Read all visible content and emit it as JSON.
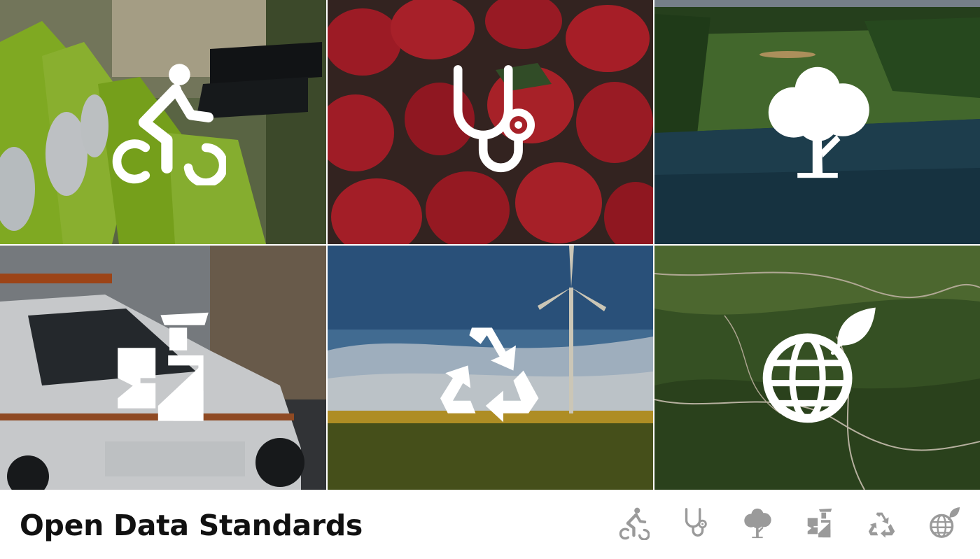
{
  "page_title": "Open Data Standards",
  "colors": {
    "title_text": "#111111",
    "tile_icon": "#ffffff",
    "footer_icon": "#9a9a9a",
    "footer_background": "#ffffff"
  },
  "categories": [
    {
      "icon": "bicycle-icon",
      "photo": "green rental bicycles in a docking station"
    },
    {
      "icon": "stethoscope-icon",
      "photo": "pile of fresh strawberries"
    },
    {
      "icon": "tree-icon",
      "photo": "aerial view of a park with a lake"
    },
    {
      "icon": "police-officer-icon",
      "photo": "police car parked on a city street"
    },
    {
      "icon": "recycle-icon",
      "photo": "wind turbine above a sunflower field"
    },
    {
      "icon": "globe-leaf-icon",
      "photo": "aerial view of green hills with winding roads"
    }
  ]
}
